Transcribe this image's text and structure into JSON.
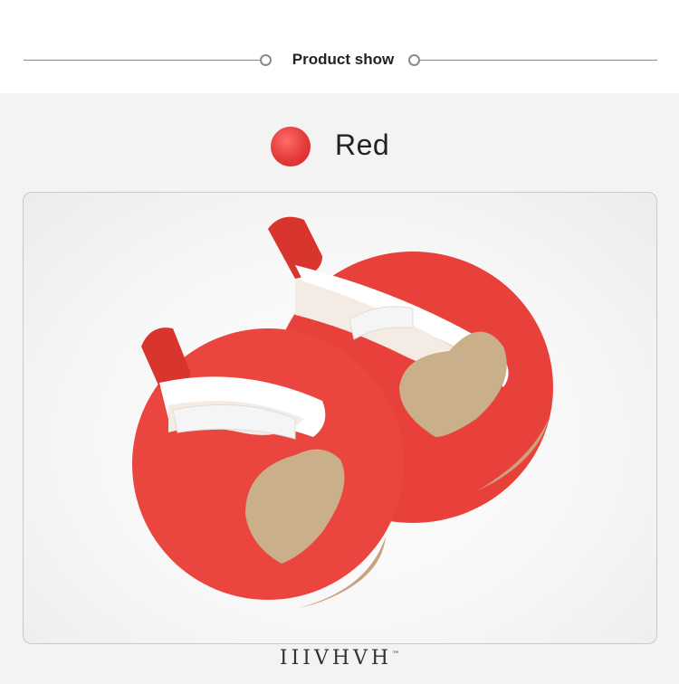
{
  "header": {
    "title": "Product show"
  },
  "variant": {
    "color_name": "Red",
    "swatch_color": "#e53a3a"
  },
  "photo": {
    "subject": "shoe-photo",
    "shoe_color": "#e8413b",
    "heart_color": "#c9b08a"
  },
  "brand": {
    "name": "IIIVHVH",
    "mark": "™"
  }
}
